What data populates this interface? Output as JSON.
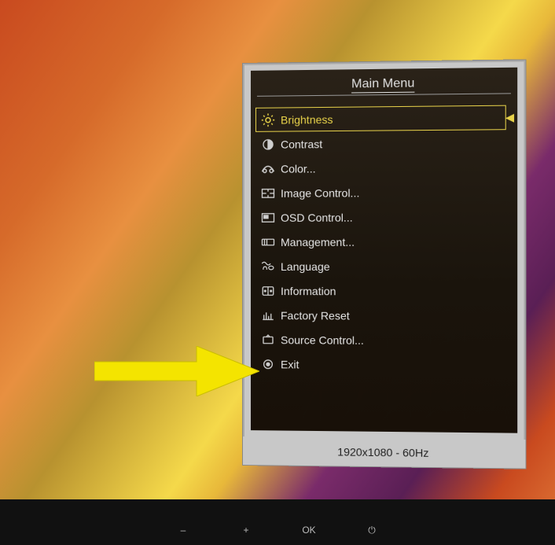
{
  "title": "Main Menu",
  "footer": "1920x1080 - 60Hz",
  "selected_index": 0,
  "arrow_target_index": 9,
  "items": [
    {
      "label": "Brightness",
      "icon": "brightness-icon"
    },
    {
      "label": "Contrast",
      "icon": "contrast-icon"
    },
    {
      "label": "Color...",
      "icon": "color-icon"
    },
    {
      "label": "Image Control...",
      "icon": "image-control-icon"
    },
    {
      "label": "OSD Control...",
      "icon": "osd-control-icon"
    },
    {
      "label": "Management...",
      "icon": "management-icon"
    },
    {
      "label": "Language",
      "icon": "language-icon"
    },
    {
      "label": "Information",
      "icon": "information-icon"
    },
    {
      "label": "Factory Reset",
      "icon": "factory-reset-icon"
    },
    {
      "label": "Source Control...",
      "icon": "source-control-icon"
    },
    {
      "label": "Exit",
      "icon": "exit-icon"
    }
  ],
  "bezel_buttons": [
    "–",
    "+",
    "OK",
    "⏻"
  ]
}
